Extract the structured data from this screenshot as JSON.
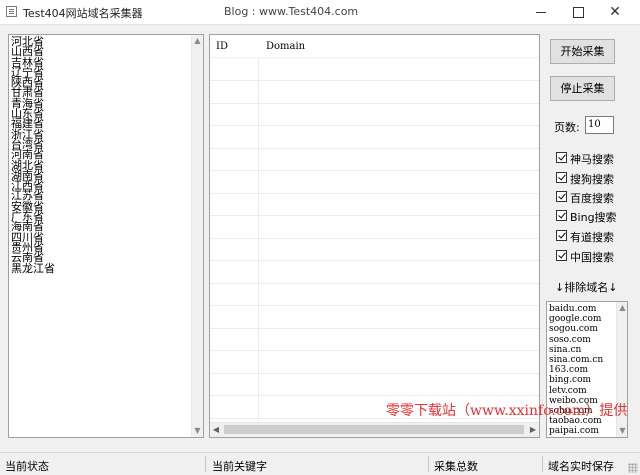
{
  "window": {
    "title": "Test404网站域名采集器",
    "blog": "Blog : www.Test404.com"
  },
  "provinces": [
    "河北省",
    "山西省",
    "吉林省",
    "辽宁省",
    "陕西省",
    "甘肃省",
    "青海省",
    "山东省",
    "福建省",
    "浙江省",
    "台湾省",
    "河南省",
    "湖北省",
    "湖南省",
    "江西省",
    "江苏省",
    "安徽省",
    "广东省",
    "海南省",
    "四川省",
    "贵州省",
    "云南省",
    "黑龙江省"
  ],
  "grid": {
    "col_id": "ID",
    "col_domain": "Domain"
  },
  "buttons": {
    "start": "开始采集",
    "stop": "停止采集"
  },
  "pages": {
    "label": "页数:",
    "value": "10"
  },
  "engines": [
    {
      "label": "神马搜索",
      "checked": true
    },
    {
      "label": "搜狗搜索",
      "checked": true
    },
    {
      "label": "百度搜索",
      "checked": true
    },
    {
      "label": "Bing搜索",
      "checked": true
    },
    {
      "label": "有道搜索",
      "checked": true
    },
    {
      "label": "中国搜索",
      "checked": true
    }
  ],
  "exclude": {
    "label": "↓排除域名↓",
    "domains": [
      "baidu.com",
      "google.com",
      "sogou.com",
      "soso.com",
      "sina.cn",
      "sina.com.cn",
      "163.com",
      "bing.com",
      "letv.com",
      "weibo.com",
      "sohu.com",
      "taobao.com",
      "paipai.com"
    ]
  },
  "watermark": "零零下载站（www.xxinfo.com）提供",
  "status": {
    "current_state": "当前状态",
    "current_keyword": "当前关键字",
    "collected": "采集总数",
    "realtime_save": "域名实时保存"
  }
}
